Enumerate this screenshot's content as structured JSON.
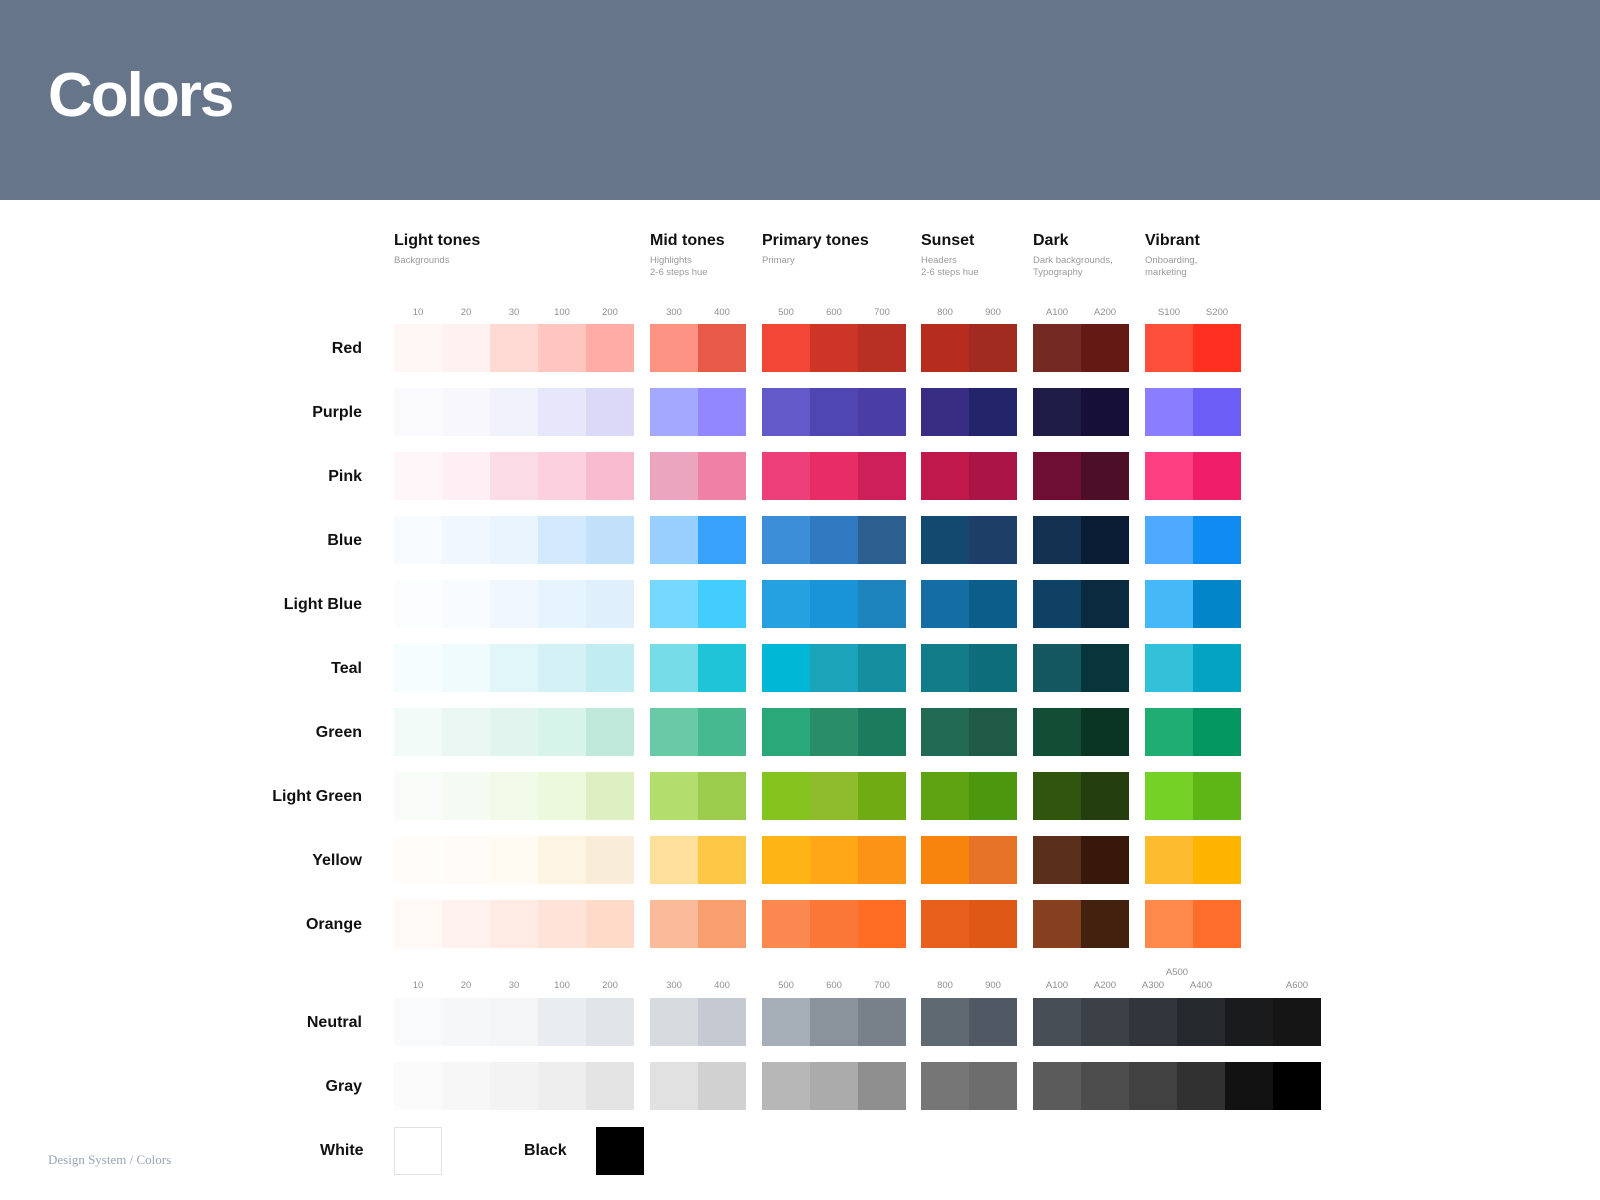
{
  "header": {
    "title": "Colors"
  },
  "groups": [
    {
      "title": "Light tones",
      "subtitle": "Backgrounds"
    },
    {
      "title": "Mid tones",
      "subtitle": "Highlights\n2-6 steps hue"
    },
    {
      "title": "Primary tones",
      "subtitle": "Primary"
    },
    {
      "title": "Sunset",
      "subtitle": "Headers\n2-6 steps hue"
    },
    {
      "title": "Dark",
      "subtitle": "Dark backgrounds,\nTypography"
    },
    {
      "title": "Vibrant",
      "subtitle": "Onboarding,\nmarketing"
    }
  ],
  "steps": [
    "10",
    "20",
    "30",
    "100",
    "200",
    "300",
    "400",
    "500",
    "600",
    "700",
    "800",
    "900",
    "A100",
    "A200",
    "S100",
    "S200"
  ],
  "bottom_steps": [
    "10",
    "20",
    "30",
    "100",
    "200",
    "300",
    "400",
    "500",
    "600",
    "700",
    "800",
    "900",
    "A100",
    "A200",
    "A300",
    "A400",
    "A500",
    "A600"
  ],
  "colors": [
    {
      "name": "Red",
      "swatches": [
        "#fff7f6",
        "#fff2f0",
        "#ffd9d4",
        "#ffc6bf",
        "#ffada4",
        "#fc9385",
        "#e65a47",
        "#f24737",
        "#cd3526",
        "#b82f23",
        "#b62d1f",
        "#a12b20",
        "#742a22",
        "#641a14",
        "#fe4f3c",
        "#ff301f"
      ]
    },
    {
      "name": "Purple",
      "swatches": [
        "#fafafd",
        "#f7f7fd",
        "#f2f2fc",
        "#e8e6fb",
        "#dcd8f8",
        "#a4a8ff",
        "#9387fe",
        "#6459c9",
        "#5046b2",
        "#4a3ea6",
        "#382d82",
        "#24246a",
        "#1f1c48",
        "#160f37",
        "#8a7dff",
        "#6d5ef7"
      ]
    },
    {
      "name": "Pink",
      "swatches": [
        "#fff6f9",
        "#fdeff4",
        "#fbdce6",
        "#fdd0df",
        "#f8bbd0",
        "#eca5bf",
        "#ef80a6",
        "#ed407a",
        "#e72c66",
        "#cf1f5b",
        "#c0184b",
        "#ab1447",
        "#6e0f33",
        "#4d0f27",
        "#fe4083",
        "#f01e69"
      ]
    },
    {
      "name": "Blue",
      "swatches": [
        "#f7fbff",
        "#f0f7ff",
        "#e9f4ff",
        "#d3eafe",
        "#c1e1fb",
        "#98cffe",
        "#38a2fa",
        "#3c8ed9",
        "#3179c0",
        "#2c5f8f",
        "#13486f",
        "#1d3f67",
        "#153152",
        "#091c34",
        "#4eaaff",
        "#108bf1"
      ]
    },
    {
      "name": "Light Blue",
      "swatches": [
        "#fbfdff",
        "#f9fcff",
        "#f0f7fe",
        "#e6f4fd",
        "#dff0fc",
        "#75d9ff",
        "#43cdfe",
        "#25a1e2",
        "#1a94d9",
        "#1d84bd",
        "#146ea3",
        "#0c5d8a",
        "#0e4163",
        "#0a2a3f",
        "#45b9f8",
        "#0285c9"
      ]
    },
    {
      "name": "Teal",
      "swatches": [
        "#f6fdfe",
        "#effbfc",
        "#e1f6f9",
        "#d4f2f6",
        "#c1ecf1",
        "#76dde8",
        "#1fc4d9",
        "#00b7d5",
        "#1aa3b9",
        "#148f9f",
        "#127c89",
        "#0d6d7a",
        "#145761",
        "#08343c",
        "#33c1da",
        "#03a4c2"
      ]
    },
    {
      "name": "Green",
      "swatches": [
        "#f2fbf7",
        "#eaf7f2",
        "#e1f4ed",
        "#d7f4eb",
        "#c0e9db",
        "#6ac9a7",
        "#46b990",
        "#2aa87a",
        "#2a8d6a",
        "#1c7b5c",
        "#226a53",
        "#1f5a47",
        "#134d35",
        "#0a3424",
        "#20ad73",
        "#03975f"
      ]
    },
    {
      "name": "Light Green",
      "swatches": [
        "#f9fbf8",
        "#f5faf2",
        "#f1f9e9",
        "#ecf9dc",
        "#def0c1",
        "#b3dd6c",
        "#9ccc4b",
        "#85c31f",
        "#8fbc2c",
        "#70ab13",
        "#5fa211",
        "#4d970e",
        "#30550f",
        "#253e0f",
        "#75d126",
        "#5db615"
      ]
    },
    {
      "name": "Yellow",
      "swatches": [
        "#fffcf9",
        "#fffbf6",
        "#fffaf2",
        "#fdf4e4",
        "#f9edd9",
        "#ffdf9c",
        "#fdc845",
        "#feb414",
        "#ffa716",
        "#fb9316",
        "#f8840e",
        "#e77426",
        "#5a2f1c",
        "#37180b",
        "#fdbc2f",
        "#ffb400"
      ]
    },
    {
      "name": "Orange",
      "swatches": [
        "#fff8f5",
        "#fff2ee",
        "#ffebe4",
        "#ffe3d9",
        "#ffdac8",
        "#fbbb9b",
        "#f99e6f",
        "#fb894f",
        "#fa7738",
        "#ff6c23",
        "#e9601c",
        "#e05816",
        "#854020",
        "#44200f",
        "#fe894b",
        "#ff6d2a"
      ]
    }
  ],
  "neutral": {
    "name": "Neutral",
    "swatches": [
      "#f9fafc",
      "#f6f7f9",
      "#f3f5f7",
      "#e9ecf0",
      "#e1e4e9",
      "#d7dbe0",
      "#c5cad2",
      "#a6aeb7",
      "#8a929b",
      "#78818a",
      "#5f6972",
      "#505963",
      "#474e56",
      "#3c4148",
      "#32353b",
      "#25282d",
      "#1a1b1c",
      "#151515"
    ]
  },
  "gray": {
    "name": "Gray",
    "swatches": [
      "#fbfbfb",
      "#f7f7f7",
      "#f3f3f3",
      "#eeeeee",
      "#e4e4e4",
      "#e1e1e1",
      "#d1d1d1",
      "#b7b7b7",
      "#ababab",
      "#8f8f8f",
      "#767676",
      "#6d6d6d",
      "#5b5b5b",
      "#4d4d4d",
      "#414141",
      "#313131",
      "#121212",
      "#000000"
    ]
  },
  "singles": [
    {
      "name": "White",
      "color": "#ffffff"
    },
    {
      "name": "Black",
      "color": "#000000"
    }
  ],
  "footer": {
    "text": "Design System / Colors"
  }
}
